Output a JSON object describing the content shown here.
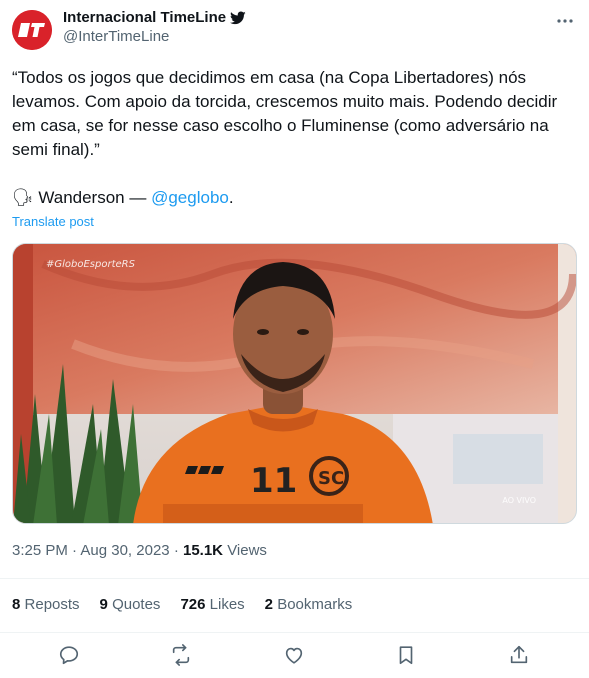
{
  "author": {
    "display_name": "Internacional TimeLine",
    "handle": "@InterTimeLine",
    "avatar_text": "It"
  },
  "tweet": {
    "text": "“Todos os jogos que decidimos em casa (na Copa Libertadores) nós levamos. Com apoio da torcida, crescemos muito mais. Podendo decidir em casa, se for nesse caso escolho o Fluminense (como adversário na semi final).”",
    "signature_emoji": "🗣",
    "signature_name": "Wanderson —",
    "signature_link": "@geglobo",
    "signature_end": ".",
    "translate_label": "Translate post"
  },
  "media": {
    "watermark": "#GloboEsporteRS",
    "live_label": "AO VIVO",
    "jersey_number": "11"
  },
  "meta": {
    "time": "3:25 PM",
    "separator": "·",
    "date": "Aug 30, 2023",
    "views_count": "15.1K",
    "views_label": "Views"
  },
  "stats": {
    "reposts_count": "8",
    "reposts_label": "Reposts",
    "quotes_count": "9",
    "quotes_label": "Quotes",
    "likes_count": "726",
    "likes_label": "Likes",
    "bookmarks_count": "2",
    "bookmarks_label": "Bookmarks"
  },
  "icons": {
    "verified": "verified-badge-icon",
    "more": "more-options-icon",
    "reply": "reply-icon",
    "repost": "repost-icon",
    "like": "like-icon",
    "bookmark": "bookmark-icon",
    "share": "share-icon"
  },
  "colors": {
    "link": "#1d9bf0",
    "brand_red": "#d9222a",
    "secondary_text": "#536471"
  }
}
